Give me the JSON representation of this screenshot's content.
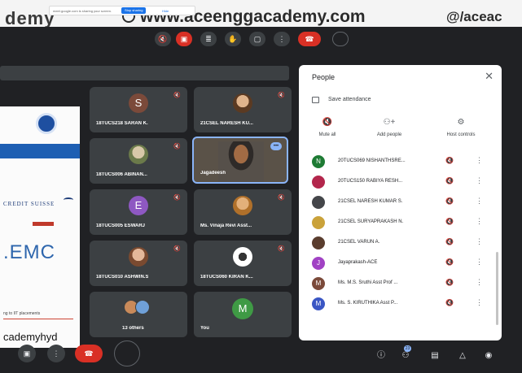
{
  "watermark": {
    "logo_text": "demy",
    "url": "www.aceenggacademy.com",
    "handle": "@/aceac"
  },
  "share_bar": {
    "message": "meet.google.com is sharing your screen.",
    "stop_label": "Stop sharing",
    "hide_label": "Hide"
  },
  "top_controls": [
    "mic-off-icon",
    "camera-off-icon",
    "captions-icon",
    "hand-icon",
    "present-icon",
    "more-icon",
    "hangup-icon",
    "blank-circle"
  ],
  "slide": {
    "sponsor1": "CREDIT SUISSE",
    "sponsor2": ".EMC",
    "small_text": "ng to IIT placements",
    "footer": "cademyhyd"
  },
  "tiles": [
    {
      "name": "18TUCS218 SARAN K.",
      "avatar": "S",
      "color": "#7b4a3a",
      "kind": "letter"
    },
    {
      "name": "21CSEL NARESH KU...",
      "avatar": "",
      "color": "",
      "kind": "photo"
    },
    {
      "name": "18TUCS006 ABINAN...",
      "avatar": "",
      "color": "",
      "kind": "photo"
    },
    {
      "name": "Jagadeesh",
      "avatar": "",
      "color": "",
      "kind": "video"
    },
    {
      "name": "18TUCS005 ESWARJ",
      "avatar": "E",
      "color": "#8e58c2",
      "kind": "letter"
    },
    {
      "name": "Ms. Vinaja Revi Asst...",
      "avatar": "",
      "color": "",
      "kind": "photo"
    },
    {
      "name": "18TUCS010 ASHWIN.S",
      "avatar": "",
      "color": "",
      "kind": "photo"
    },
    {
      "name": "18TUCS060 KIRAN K...",
      "avatar": "",
      "color": "",
      "kind": "emblem"
    },
    {
      "name": "13 others",
      "avatar": "",
      "color": "",
      "kind": "others"
    },
    {
      "name": "You",
      "avatar": "M",
      "color": "#3f9a45",
      "kind": "letter"
    }
  ],
  "people_panel": {
    "title": "People",
    "attendance": "Save attendance",
    "actions": [
      {
        "icon": "mute-all-icon",
        "label": "Mute all"
      },
      {
        "icon": "add-people-icon",
        "label": "Add people"
      },
      {
        "icon": "host-controls-icon",
        "label": "Host controls"
      }
    ],
    "participants": [
      {
        "name": "20TUCS069 NISHANTHSRE...",
        "avatar": "N",
        "color": "#1e7b34"
      },
      {
        "name": "20TUCS150 RABIYA RESH...",
        "avatar": "",
        "color": "#b3264c"
      },
      {
        "name": "21CSEL NARESH KUMAR S.",
        "avatar": "",
        "color": "#44464a"
      },
      {
        "name": "21CSEL SURYAPRAKASH N.",
        "avatar": "",
        "color": "#caa23a"
      },
      {
        "name": "21CSEL VARUN A.",
        "avatar": "",
        "color": "#5a3d2e"
      },
      {
        "name": "Jayaprakash-ACE",
        "avatar": "J",
        "color": "#a142c4"
      },
      {
        "name": "Ms. M.S. Sruthi Asst Prof ...",
        "avatar": "M",
        "color": "#7b4a3a"
      },
      {
        "name": "Ms. S. KIRUTHIKA Asst P...",
        "avatar": "M",
        "color": "#3a56c4"
      }
    ]
  },
  "bottom_bar": {
    "people_count": "23"
  }
}
